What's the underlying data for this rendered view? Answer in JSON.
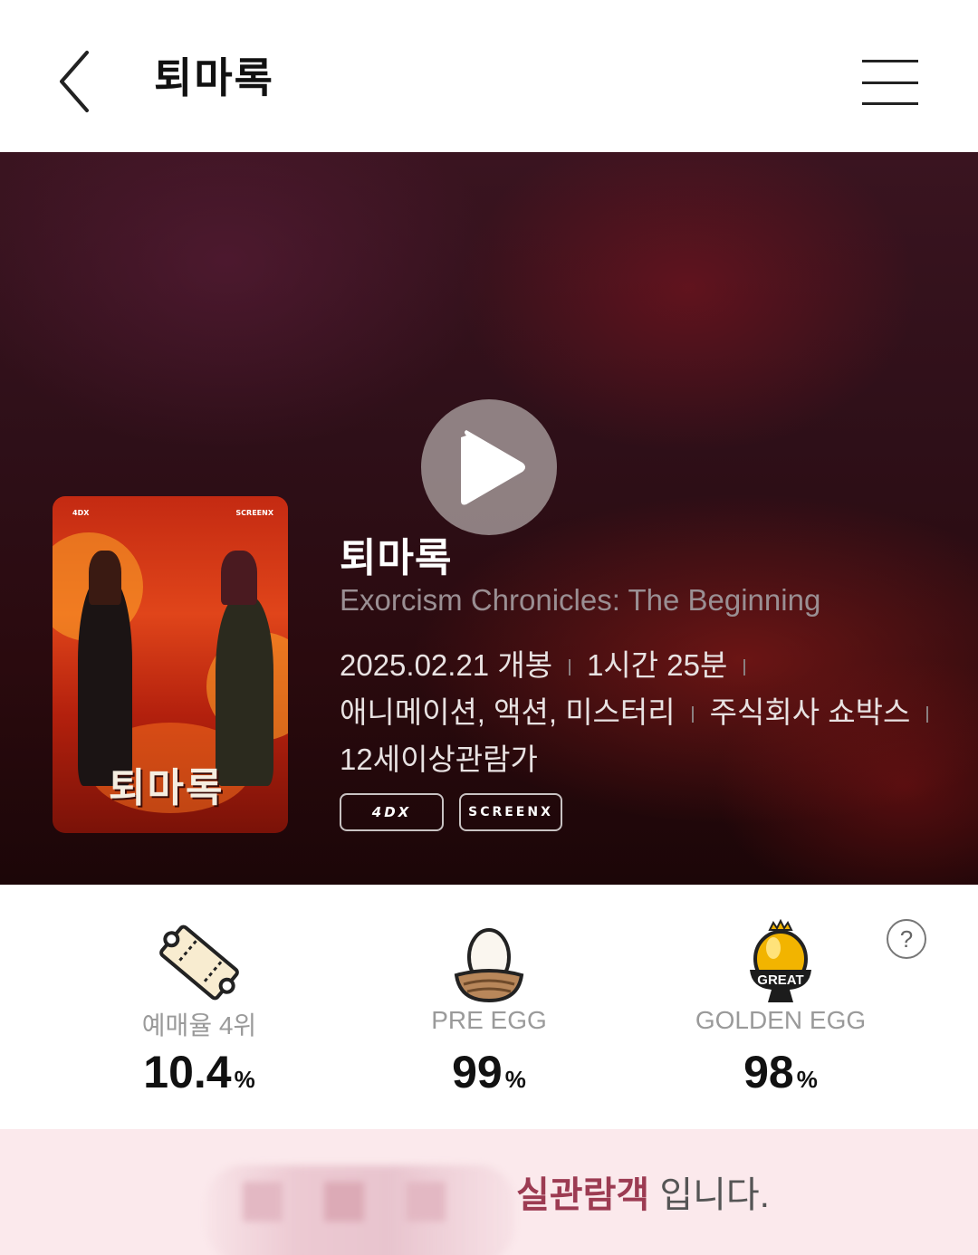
{
  "header": {
    "title": "퇴마록"
  },
  "movie": {
    "title": "퇴마록",
    "subtitle": "Exorcism Chronicles: The Beginning",
    "release": "2025.02.21 개봉",
    "runtime": "1시간 25분",
    "genres": "애니메이션, 액션, 미스터리",
    "distributor": "주식회사 쇼박스",
    "rating": "12세이상관람가",
    "formats": [
      "4DX",
      "SCREENX"
    ],
    "poster": {
      "title_text": "퇴마록",
      "badge_left": "4DX",
      "badge_right": "SCREENX"
    }
  },
  "stats": [
    {
      "label": "예매율 4위",
      "value": "10.4",
      "unit": "%",
      "icon": "ticket-icon"
    },
    {
      "label": "PRE EGG",
      "value": "99",
      "unit": "%",
      "icon": "egg-nest-icon"
    },
    {
      "label": "GOLDEN EGG",
      "value": "98",
      "unit": "%",
      "icon": "golden-egg-great-icon",
      "icon_text": "GREAT"
    }
  ],
  "help": {
    "symbol": "?"
  },
  "banner": {
    "strong": "실관람객",
    "rest": " 입니다."
  },
  "colors": {
    "hero_dark": "#2a0a0e",
    "accent": "#9c3b52",
    "banner_bg": "#fbe9ec",
    "golden_egg": "#f2b400"
  }
}
